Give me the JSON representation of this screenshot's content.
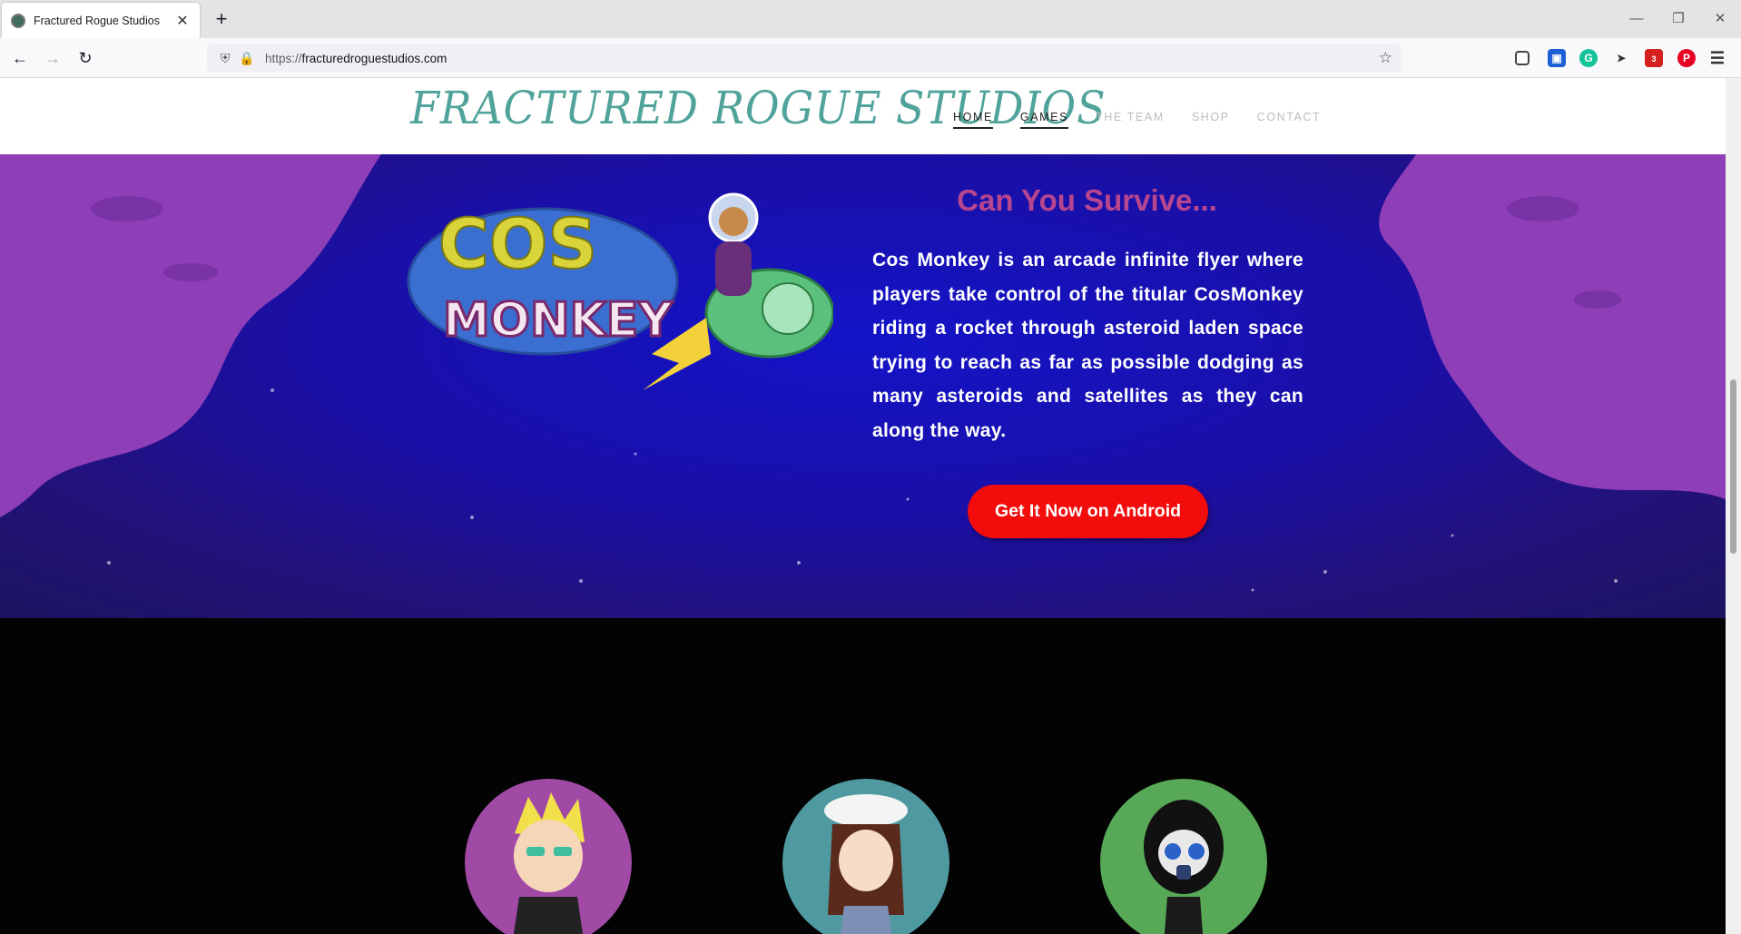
{
  "browser": {
    "tab_title": "Fractured Rogue Studios",
    "tab_close": "✕",
    "new_tab": "+",
    "url_prefix": "https://",
    "url_host": "fracturedroguestudios.com",
    "badge_count": "3"
  },
  "site": {
    "logo_text": "FRACTURED ROGUE STUDIOS",
    "nav": [
      {
        "label": "HOME",
        "active": true
      },
      {
        "label": "GAMES",
        "active": true
      },
      {
        "label": "THE TEAM",
        "active": false
      },
      {
        "label": "SHOP",
        "active": false
      },
      {
        "label": "CONTACT",
        "active": false
      }
    ]
  },
  "hero": {
    "game_logo_word1": "COS",
    "game_logo_word2": "MONKEY",
    "title": "Can You Survive...",
    "description": "Cos Monkey is an arcade infinite flyer where players take control of the titular CosMonkey riding a rocket through asteroid laden space trying to reach as far as possible dodging as many asteroids and satellites as they can along the way.",
    "cta_label": "Get It Now on Android",
    "colors": {
      "cta": "#f20c0c",
      "title": "#b8468f",
      "blob": "#8e3fb8",
      "space": "#1a0fa6"
    }
  },
  "team": {
    "avatars": [
      {
        "icon": "blonde-character-avatar",
        "color": "#a04aa5"
      },
      {
        "icon": "cat-hat-character-avatar",
        "color": "#4f9aa0"
      },
      {
        "icon": "gasmask-character-avatar",
        "color": "#57a857"
      }
    ]
  }
}
